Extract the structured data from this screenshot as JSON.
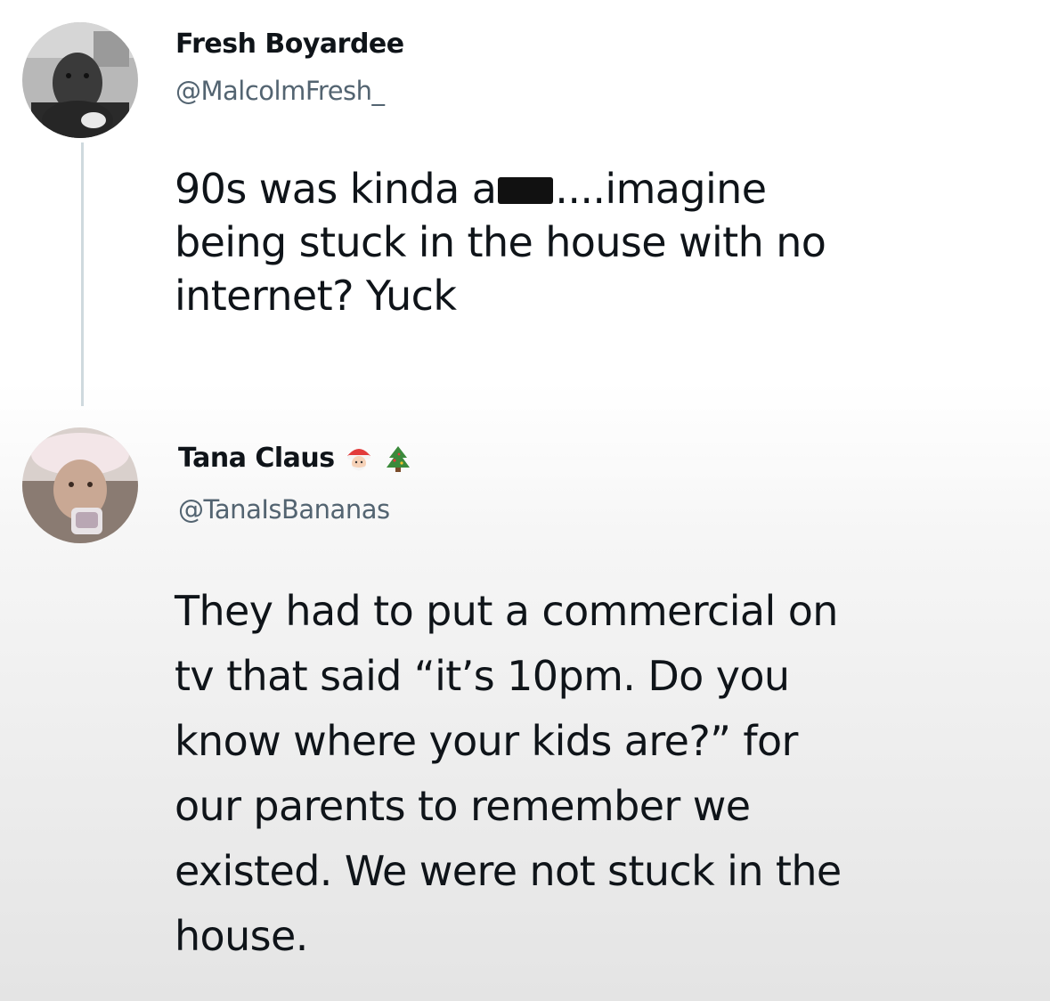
{
  "tweets": [
    {
      "display_name": "Fresh Boyardee",
      "handle": "@MalcolmFresh_",
      "text_lines": [
        {
          "before": "90s was kinda a",
          "after": "....imagine"
        },
        "being stuck in the house with no",
        "internet? Yuck"
      ],
      "avatar_icon": "profile-photo-man"
    },
    {
      "display_name": "Tana Claus",
      "handle": "@TanaIsBananas",
      "name_emojis": [
        "santa-emoji",
        "christmas-tree-emoji"
      ],
      "text_lines": [
        "They had to put a commercial on",
        "tv that said “it’s 10pm. Do you",
        "know where your kids are?” for",
        "our parents to remember we",
        "existed. We were not stuck in the",
        "house."
      ],
      "avatar_icon": "profile-photo-woman-santa-hat"
    }
  ]
}
